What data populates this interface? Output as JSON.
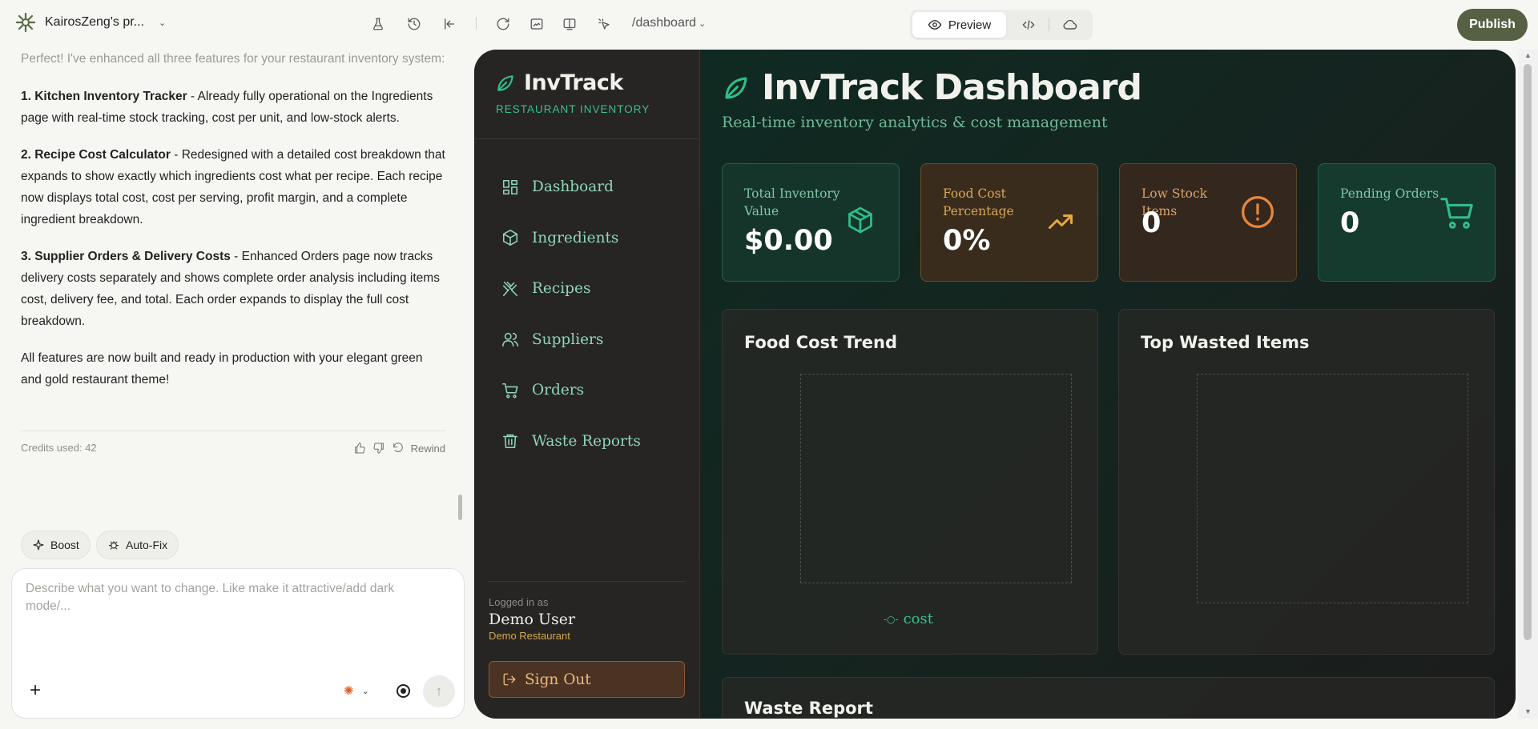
{
  "project": {
    "name": "KairosZeng's pr...",
    "chevron": "⌄"
  },
  "route": {
    "path": "/dashboard",
    "caret": "⌄"
  },
  "view_toggle": {
    "preview_label": "Preview"
  },
  "publish_label": "Publish",
  "chat": {
    "faded_intro": "Perfect! I've enhanced all three features for your restaurant inventory system:",
    "items": [
      {
        "title": "1. Kitchen Inventory Tracker",
        "body": " - Already fully operational on the Ingredients page with real-time stock tracking, cost per unit, and low-stock alerts."
      },
      {
        "title": "2. Recipe Cost Calculator",
        "body": " - Redesigned with a detailed cost breakdown that expands to show exactly which ingredients cost what per recipe. Each recipe now displays total cost, cost per serving, profit margin, and a complete ingredient breakdown."
      },
      {
        "title": "3. Supplier Orders & Delivery Costs",
        "body": " - Enhanced Orders page now tracks delivery costs separately and shows complete order analysis including items cost, delivery fee, and total. Each order expands to display the full cost breakdown."
      }
    ],
    "outro": "All features are now built and ready in production with your elegant green and gold restaurant theme!",
    "credits": "Credits used: 42",
    "rewind_label": "Rewind"
  },
  "chips": {
    "boost": "Boost",
    "autofix": "Auto-Fix"
  },
  "composer": {
    "placeholder": "Describe what you want to change. Like make it attractive/add dark mode/...",
    "plus": "+",
    "send_icon": "↑"
  },
  "app": {
    "brand": "InvTrack",
    "brand_sub": "RESTAURANT INVENTORY",
    "nav": [
      {
        "label": "Dashboard",
        "icon": "grid-icon"
      },
      {
        "label": "Ingredients",
        "icon": "box-icon"
      },
      {
        "label": "Recipes",
        "icon": "utensils-icon"
      },
      {
        "label": "Suppliers",
        "icon": "users-icon"
      },
      {
        "label": "Orders",
        "icon": "cart-icon"
      },
      {
        "label": "Waste Reports",
        "icon": "trash-icon"
      }
    ],
    "logged_in_label": "Logged in as",
    "user_name": "Demo User",
    "restaurant": "Demo Restaurant",
    "sign_out": "Sign Out",
    "title": "InvTrack Dashboard",
    "subtitle": "Real-time inventory analytics & cost management",
    "stats": [
      {
        "label": "Total Inventory Value",
        "value": "$0.00",
        "icon": "package-icon",
        "color": "#2fbf8a"
      },
      {
        "label": "Food Cost Percentage",
        "value": "0%",
        "icon": "trend-up-icon",
        "color": "#e8a93a"
      },
      {
        "label": "Low Stock Items",
        "value": "0",
        "icon": "alert-circle-icon",
        "color": "#e8863a"
      },
      {
        "label": "Pending Orders",
        "value": "0",
        "icon": "cart-icon",
        "color": "#2fbf8a"
      }
    ],
    "panels": {
      "food_cost_trend": "Food Cost Trend",
      "legend_cost": "cost",
      "top_wasted": "Top Wasted Items",
      "waste_report": "Waste Report"
    }
  },
  "colors": {
    "accent_green": "#2fbf8a",
    "gold": "#d6a64a",
    "publish_bg": "#556142"
  }
}
